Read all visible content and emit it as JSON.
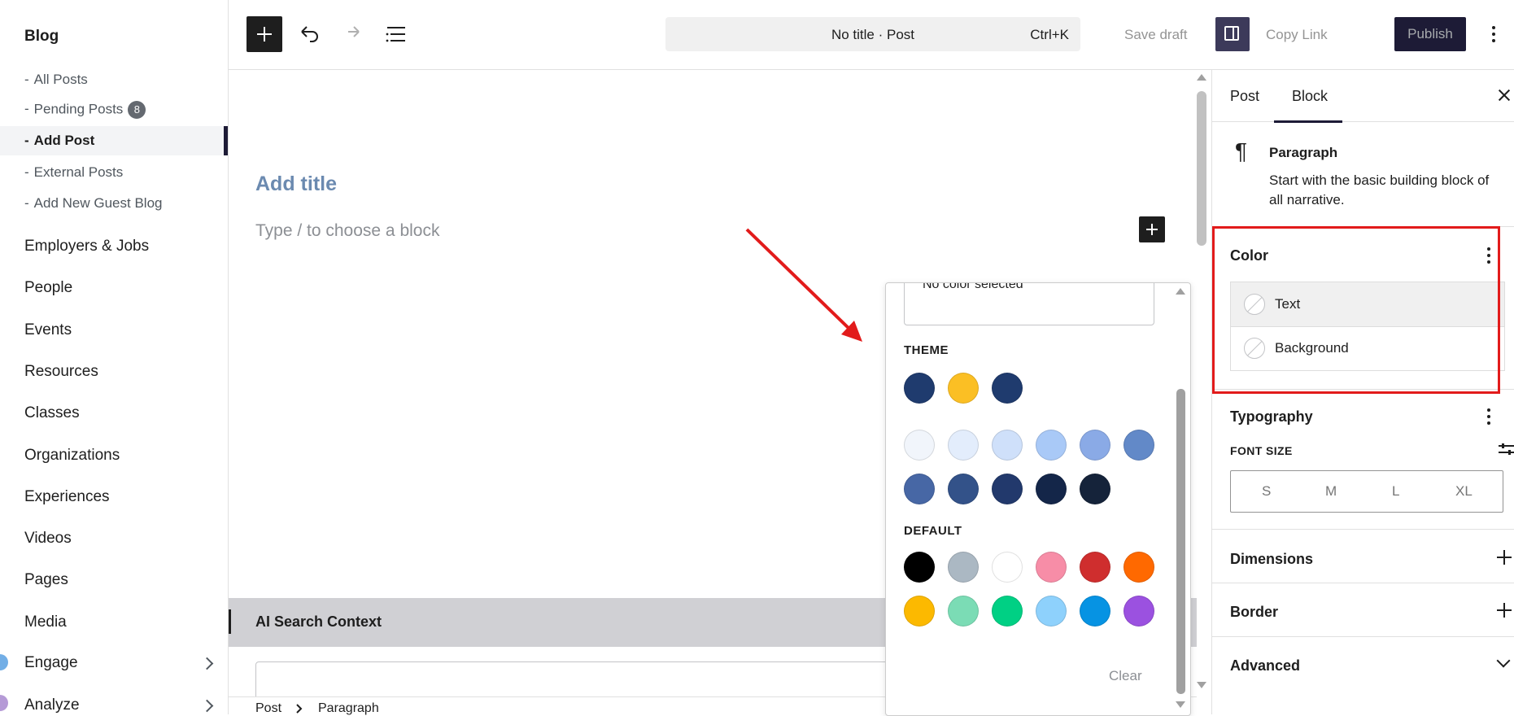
{
  "sidebar": {
    "section_title": "Blog",
    "sub_items": [
      {
        "label": "All Posts"
      },
      {
        "label": "Pending Posts",
        "badge": "8"
      },
      {
        "label": "Add Post",
        "active": true
      },
      {
        "label": "External Posts"
      },
      {
        "label": "Add New Guest Blog"
      }
    ],
    "dash": "-",
    "nav": [
      {
        "label": "Employers & Jobs"
      },
      {
        "label": "People"
      },
      {
        "label": "Events"
      },
      {
        "label": "Resources"
      },
      {
        "label": "Classes"
      },
      {
        "label": "Organizations"
      },
      {
        "label": "Experiences"
      },
      {
        "label": "Videos"
      },
      {
        "label": "Pages"
      },
      {
        "label": "Media"
      },
      {
        "label": "Engage",
        "expandable": true
      },
      {
        "label": "Analyze",
        "expandable": true
      }
    ]
  },
  "toolbar": {
    "command_title": "No title · Post",
    "command_shortcut": "Ctrl+K",
    "save_draft": "Save draft",
    "copy_link": "Copy Link",
    "publish": "Publish"
  },
  "editor": {
    "title_placeholder": "Add title",
    "block_placeholder": "Type / to choose a block",
    "ai_search_title": "AI Search Context",
    "breadcrumb": [
      "Post",
      "Paragraph"
    ]
  },
  "color_popover": {
    "preview_text": "No color selected",
    "theme_label": "THEME",
    "default_label": "DEFAULT",
    "clear_label": "Clear",
    "theme_colors": [
      "#1f3b6e",
      "#fbbf24",
      "#1f3b6e"
    ],
    "shade_colors": [
      "#f1f5fb",
      "#e3edfc",
      "#cfe0fa",
      "#a9c9f7",
      "#8aaae6",
      "#6289c8",
      "#4767a5",
      "#335289",
      "#22396c",
      "#142649",
      "#15233a"
    ],
    "default_colors": [
      "#000000",
      "#abb8c3",
      "#ffffff",
      "#f78da7",
      "#cf2e2e",
      "#ff6900",
      "#fcb900",
      "#7bdcb5",
      "#00d084",
      "#8ed1fc",
      "#0693e3",
      "#9b51e0"
    ]
  },
  "panel": {
    "tabs": [
      "Post",
      "Block"
    ],
    "active_tab": "Block",
    "block_name": "Paragraph",
    "block_description": "Start with the basic building block of all narrative.",
    "color_title": "Color",
    "color_items": [
      "Text",
      "Background"
    ],
    "typography_title": "Typography",
    "font_size_label": "FONT SIZE",
    "font_sizes": [
      "S",
      "M",
      "L",
      "XL"
    ],
    "dimensions_title": "Dimensions",
    "border_title": "Border",
    "advanced_title": "Advanced"
  },
  "colors": {
    "accent_dark": "#1d1b36",
    "annotation_red": "#e21b1b"
  }
}
